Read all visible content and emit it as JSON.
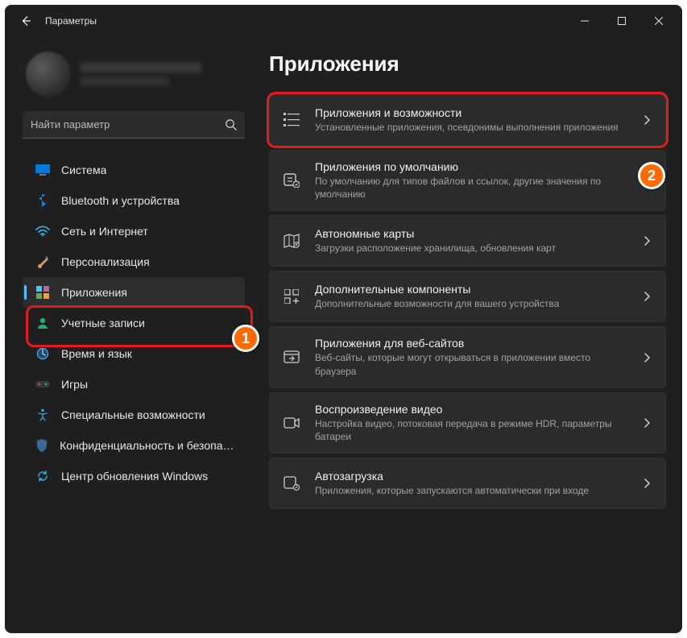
{
  "titlebar": {
    "title": "Параметры"
  },
  "search": {
    "placeholder": "Найти параметр"
  },
  "page": {
    "heading": "Приложения"
  },
  "nav": {
    "items": [
      {
        "label": "Система"
      },
      {
        "label": "Bluetooth и устройства"
      },
      {
        "label": "Сеть и Интернет"
      },
      {
        "label": "Персонализация"
      },
      {
        "label": "Приложения"
      },
      {
        "label": "Учетные записи"
      },
      {
        "label": "Время и язык"
      },
      {
        "label": "Игры"
      },
      {
        "label": "Специальные возможности"
      },
      {
        "label": "Конфиденциальность и безопасность"
      },
      {
        "label": "Центр обновления Windows"
      }
    ]
  },
  "cards": [
    {
      "title": "Приложения и возможности",
      "desc": "Установленные приложения, псевдонимы выполнения приложения"
    },
    {
      "title": "Приложения по умолчанию",
      "desc": "По умолчанию для типов файлов и ссылок, другие значения по умолчанию"
    },
    {
      "title": "Автономные карты",
      "desc": "Загрузки расположение хранилища, обновления карт"
    },
    {
      "title": "Дополнительные компоненты",
      "desc": "Дополнительные возможности для вашего устройства"
    },
    {
      "title": "Приложения для веб-сайтов",
      "desc": "Веб-сайты, которые могут открываться в приложении вместо браузера"
    },
    {
      "title": "Воспроизведение видео",
      "desc": "Настройка видео, потоковая передача в режиме HDR, параметры батареи"
    },
    {
      "title": "Автозагрузка",
      "desc": "Приложения, которые запускаются автоматически при входе"
    }
  ],
  "annotations": {
    "badge1": "1",
    "badge2": "2"
  }
}
